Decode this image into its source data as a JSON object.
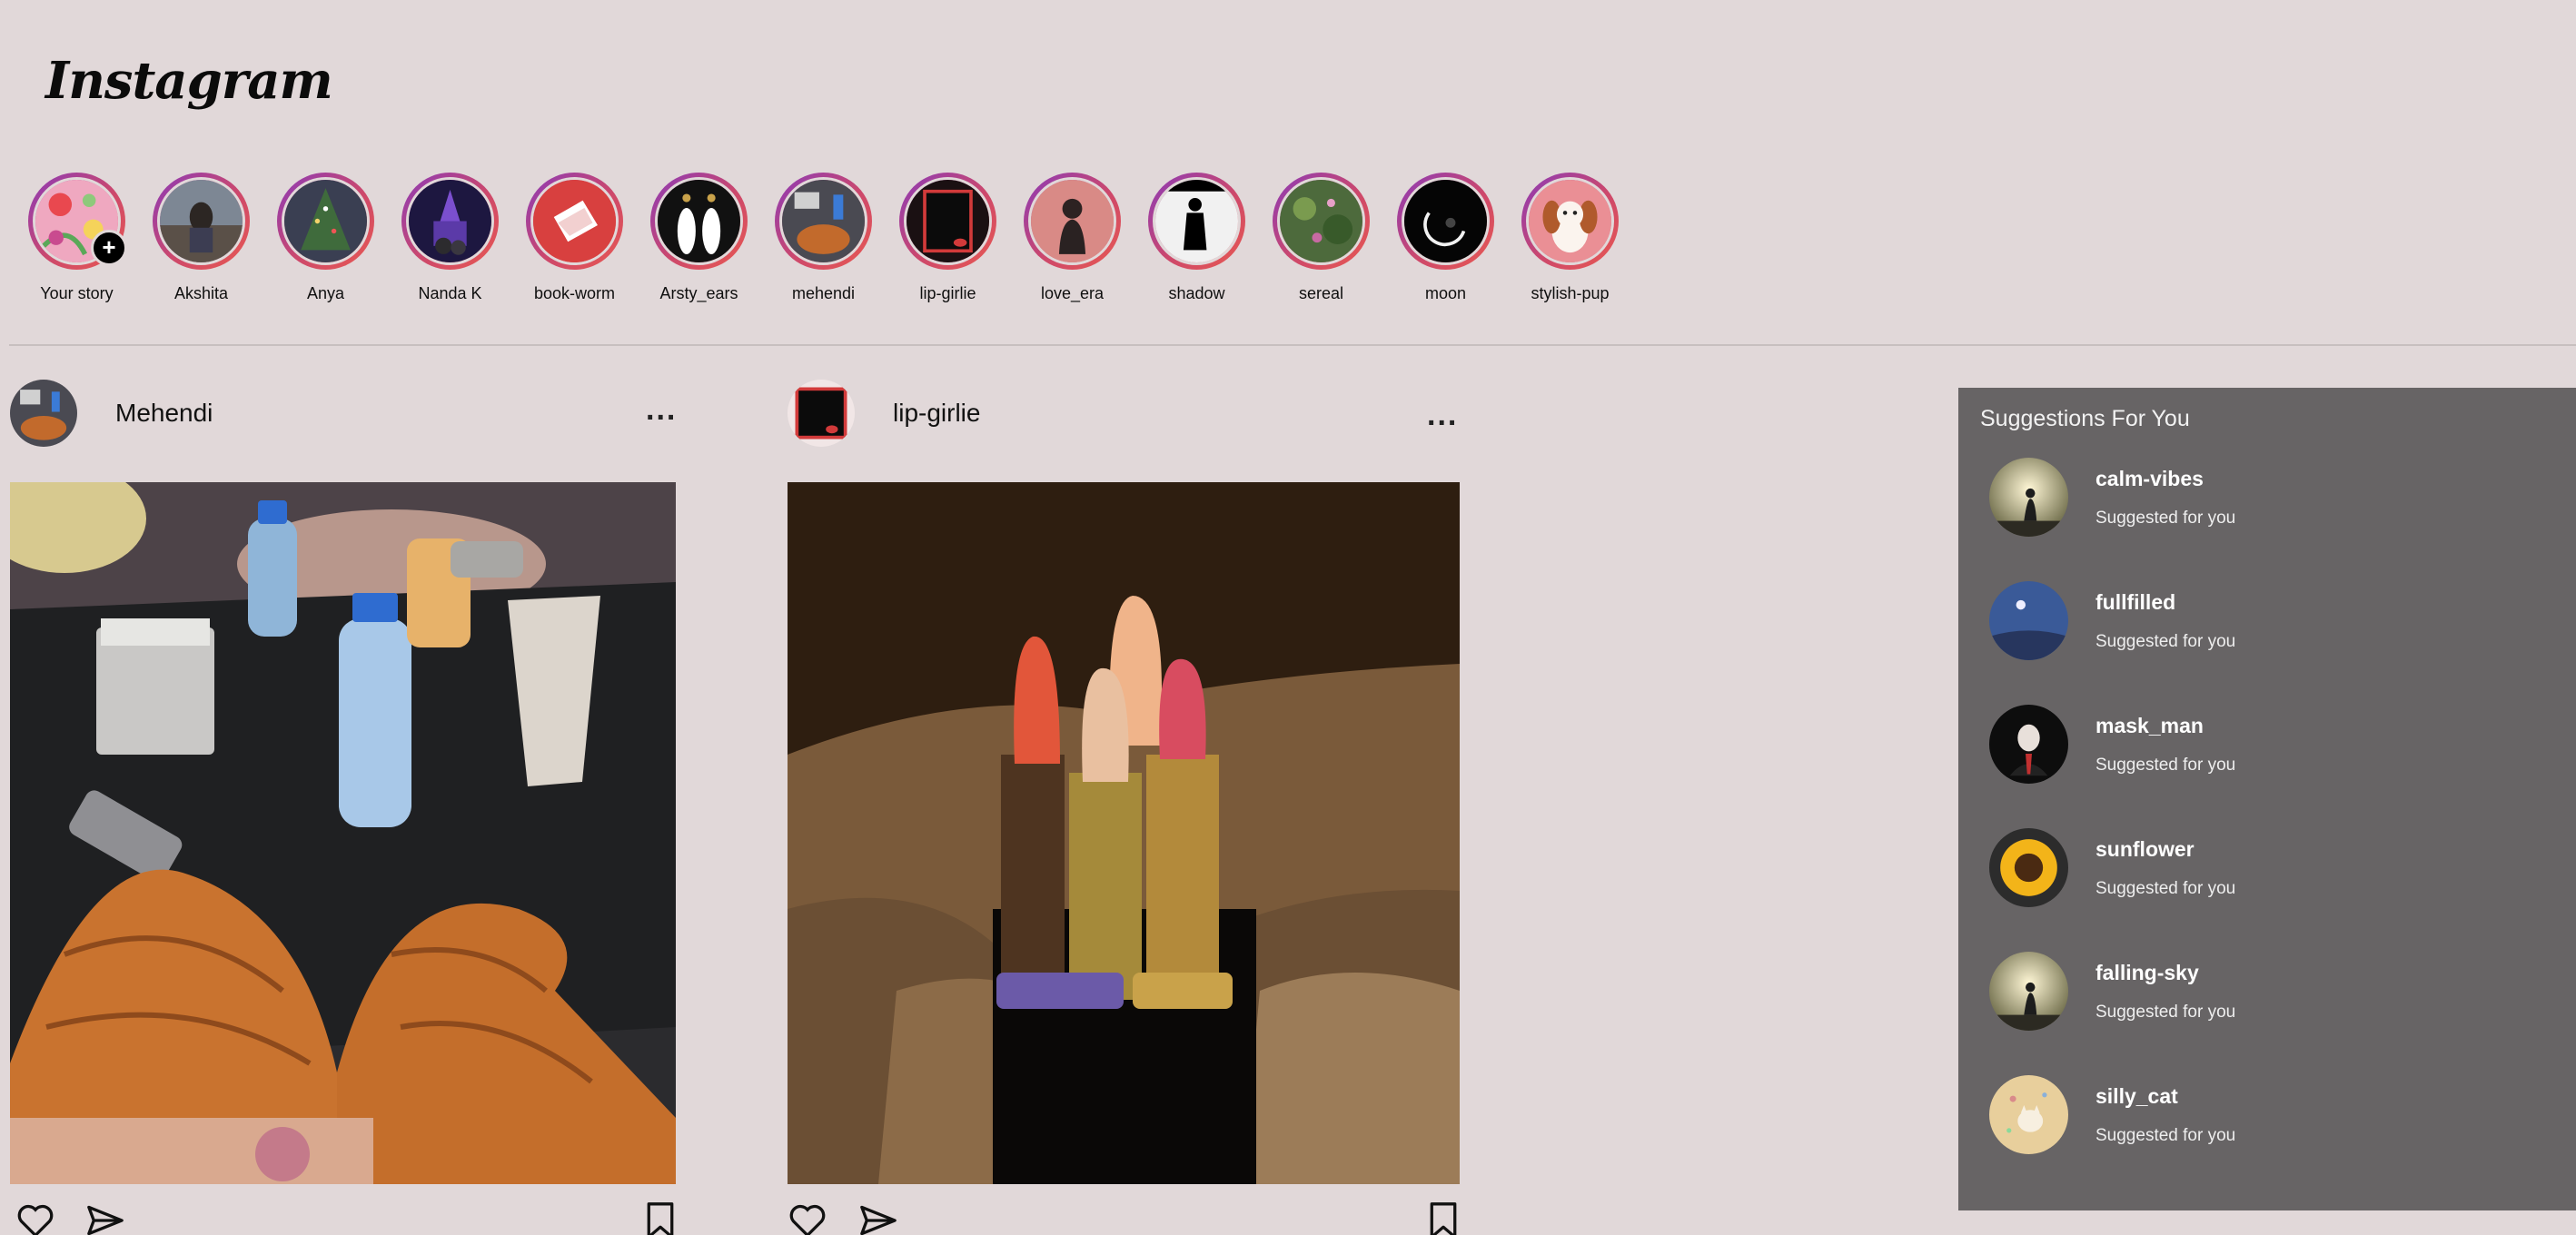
{
  "app": {
    "logo_text": "Instagram"
  },
  "stories": [
    {
      "label": "Your story",
      "icon": "your-story-avatar",
      "add_icon": "+"
    },
    {
      "label": "Akshita"
    },
    {
      "label": "Anya"
    },
    {
      "label": "Nanda K"
    },
    {
      "label": "book-worm"
    },
    {
      "label": "Arsty_ears"
    },
    {
      "label": "mehendi"
    },
    {
      "label": "lip-girlie"
    },
    {
      "label": "love_era"
    },
    {
      "label": "shadow"
    },
    {
      "label": "sereal"
    },
    {
      "label": "moon"
    },
    {
      "label": "stylish-pup"
    }
  ],
  "posts": [
    {
      "username": "Mehendi",
      "more_label": "...",
      "actions": [
        "heart-icon",
        "send-icon",
        "bookmark-icon"
      ]
    },
    {
      "username": "lip-girlie",
      "more_label": "...",
      "actions": [
        "heart-icon",
        "send-icon",
        "bookmark-icon"
      ]
    }
  ],
  "suggestions": {
    "title": "Suggestions For You",
    "items": [
      {
        "name": "calm-vibes",
        "subtitle": "Suggested for you"
      },
      {
        "name": "fullfilled",
        "subtitle": "Suggested for you"
      },
      {
        "name": "mask_man",
        "subtitle": "Suggested for you"
      },
      {
        "name": "sunflower",
        "subtitle": "Suggested for you"
      },
      {
        "name": "falling-sky",
        "subtitle": "Suggested for you"
      },
      {
        "name": "silly_cat",
        "subtitle": "Suggested for you"
      }
    ]
  },
  "colors": {
    "background": "#e1d8d9",
    "story_ring_start": "#8a3ab9",
    "story_ring_end": "#e95950",
    "suggestions_panel": "#676465"
  }
}
